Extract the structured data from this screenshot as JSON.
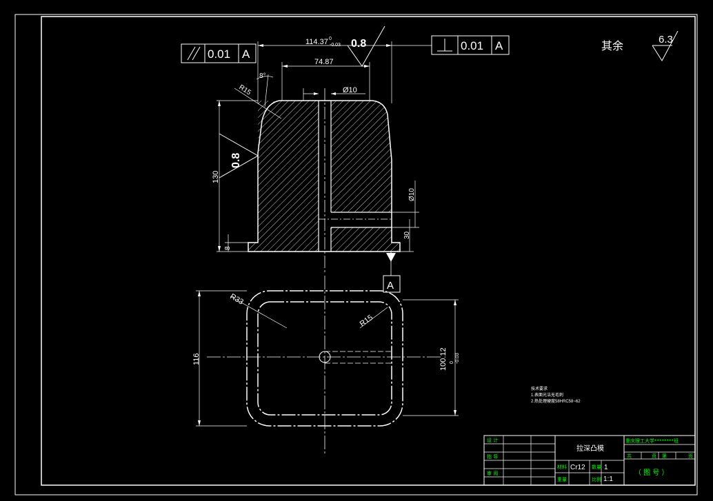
{
  "dimensions": {
    "overall_width": "114.37",
    "tol_upper": "0",
    "tol_lower": "-0.03",
    "inner_width": "74.87",
    "angle": "8°",
    "top_radius": "R15",
    "hole_dia_top": "Ø10",
    "height": "130",
    "base_step": "8",
    "hole_dia_side": "Ø10",
    "hole_depth": "30",
    "plan_radius_outer": "R33",
    "plan_radius_inner": "R15",
    "plan_width": "116",
    "plan_depth_main": "100.12",
    "plan_depth_tol": "0",
    "plan_depth_tol2": "-0.03"
  },
  "tolerances": {
    "parallel_value": "0.01",
    "parallel_datum": "A",
    "perpendicular_value": "0.01",
    "perpendicular_datum": "A",
    "datum_label": "A"
  },
  "roughness": {
    "top": "0.8",
    "side": "0.8",
    "other_label": "其余",
    "other_value": "6.3"
  },
  "notes": {
    "title": "技术要求",
    "line1": "1.表面光洁无毛刺",
    "line2": "2.热处理硬度58HRC58~62"
  },
  "title_block": {
    "design": "设 计",
    "check": "指 导",
    "review": "审 阅",
    "part_name": "拉深凸模",
    "material_label": "材料",
    "material": "Cr12",
    "quantity_label": "数量",
    "quantity": "1",
    "weight_label": "重量",
    "scale_label": "比例",
    "scale": "1:1",
    "school": "重庆理工大学********班",
    "total_label": "共",
    "pages_label": "页",
    "page_label": "第",
    "page_label2": "页",
    "drawing_no": "（ 图  号 ）"
  }
}
